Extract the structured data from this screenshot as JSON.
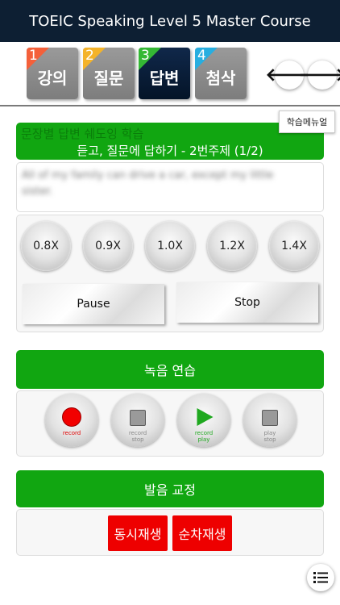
{
  "app": {
    "title": "TOEIC Speaking Level 5 Master Course"
  },
  "tabs": [
    {
      "num": "1",
      "label": "강의",
      "accent": "#f4603a",
      "active": false
    },
    {
      "num": "2",
      "label": "질문",
      "accent": "#f4b32a",
      "active": false
    },
    {
      "num": "3",
      "label": "답변",
      "accent": "#34b834",
      "active": true
    },
    {
      "num": "4",
      "label": "첨삭",
      "accent": "#27aee0",
      "active": false
    }
  ],
  "nav": {
    "prev_icon": "arrow-left-icon",
    "next_icon": "arrow-right-icon",
    "prev_glyph": "🡐",
    "next_glyph": "🡒"
  },
  "menu_tooltip": "학습메뉴얼",
  "lesson": {
    "title_ghost": "문장별 답변 쉐도잉 학습",
    "subtitle": "듣고, 질문에 답하기 - 2번주제 (1/2)",
    "sentence": "All of my family can drive a car, except my little sister."
  },
  "speeds": [
    "0.8X",
    "0.9X",
    "1.0X",
    "1.2X",
    "1.4X"
  ],
  "playback": {
    "pause_label": "Pause",
    "stop_label": "Stop"
  },
  "recording": {
    "header": "녹음 연습",
    "buttons": [
      {
        "id": "record",
        "caption": "record",
        "color": "#e00000"
      },
      {
        "id": "record-stop",
        "caption": "record\nstop",
        "color": "#888888"
      },
      {
        "id": "record-play",
        "caption": "record\nplay",
        "color": "#1fa81f"
      },
      {
        "id": "play-stop",
        "caption": "play\nstop",
        "color": "#888888"
      }
    ]
  },
  "pronunciation": {
    "header": "발음 교정",
    "simultaneous_label": "동시재생",
    "sequential_label": "순차재생"
  }
}
